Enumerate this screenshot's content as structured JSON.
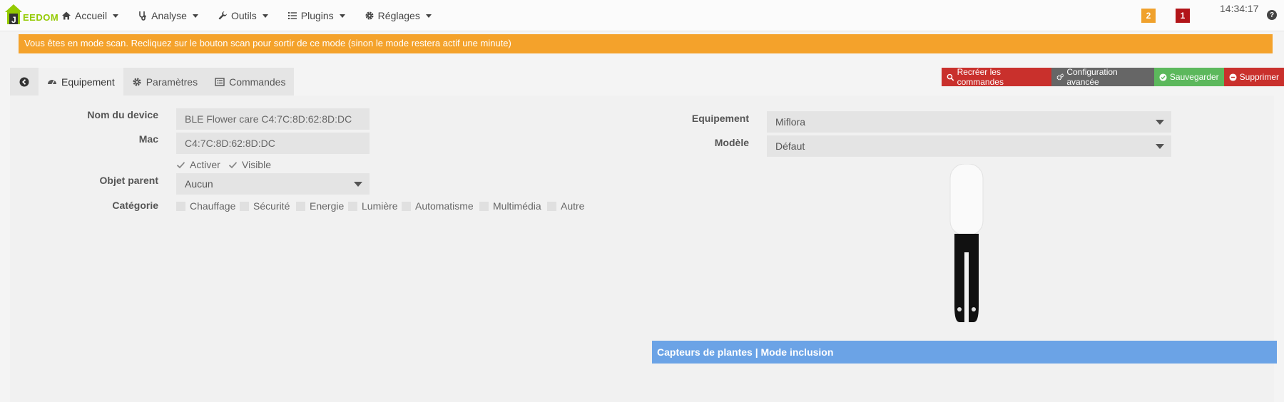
{
  "brand": {
    "name": "EEDOM"
  },
  "nav": {
    "items": [
      {
        "label": "Accueil",
        "icon": "home-icon"
      },
      {
        "label": "Analyse",
        "icon": "stethoscope-icon"
      },
      {
        "label": "Outils",
        "icon": "wrench-icon"
      },
      {
        "label": "Plugins",
        "icon": "list-icon"
      },
      {
        "label": "Réglages",
        "icon": "gear-icon"
      }
    ]
  },
  "header": {
    "badge_orange": "2",
    "badge_red": "1",
    "clock": "14:34:17",
    "help": "?"
  },
  "scan_banner": "Vous êtes en mode scan. Recliquez sur le bouton scan pour sortir de ce mode (sinon le mode restera actif une minute)",
  "tabs": [
    {
      "label": "Equipement",
      "icon": "tachometer-icon"
    },
    {
      "label": "Paramètres",
      "icon": "cog-icon"
    },
    {
      "label": "Commandes",
      "icon": "list-alt-icon"
    }
  ],
  "actions": {
    "recreate": "Recréer les commandes",
    "advanced": "Configuration avancée",
    "save": "Sauvegarder",
    "delete": "Supprimer"
  },
  "form": {
    "device_name_label": "Nom du device",
    "device_name_value": "BLE Flower care C4:7C:8D:62:8D:DC",
    "mac_label": "Mac",
    "mac_value": "C4:7C:8D:62:8D:DC",
    "activate": "Activer",
    "visible": "Visible",
    "parent_label": "Objet parent",
    "parent_value": "Aucun",
    "category_label": "Catégorie",
    "categories": [
      "Chauffage",
      "Sécurité",
      "Energie",
      "Lumière",
      "Automatisme",
      "Multimédia",
      "Autre"
    ],
    "equipment_label": "Equipement",
    "equipment_value": "Miflora",
    "model_label": "Modèle",
    "model_value": "Défaut"
  },
  "info_bar": "Capteurs de plantes | Mode inclusion",
  "colors": {
    "accent_green": "#94ca02",
    "scan_orange": "#f4a22b",
    "danger_red": "#c9302c",
    "success_green": "#5cb85c",
    "info_blue": "#6ba3e6"
  }
}
